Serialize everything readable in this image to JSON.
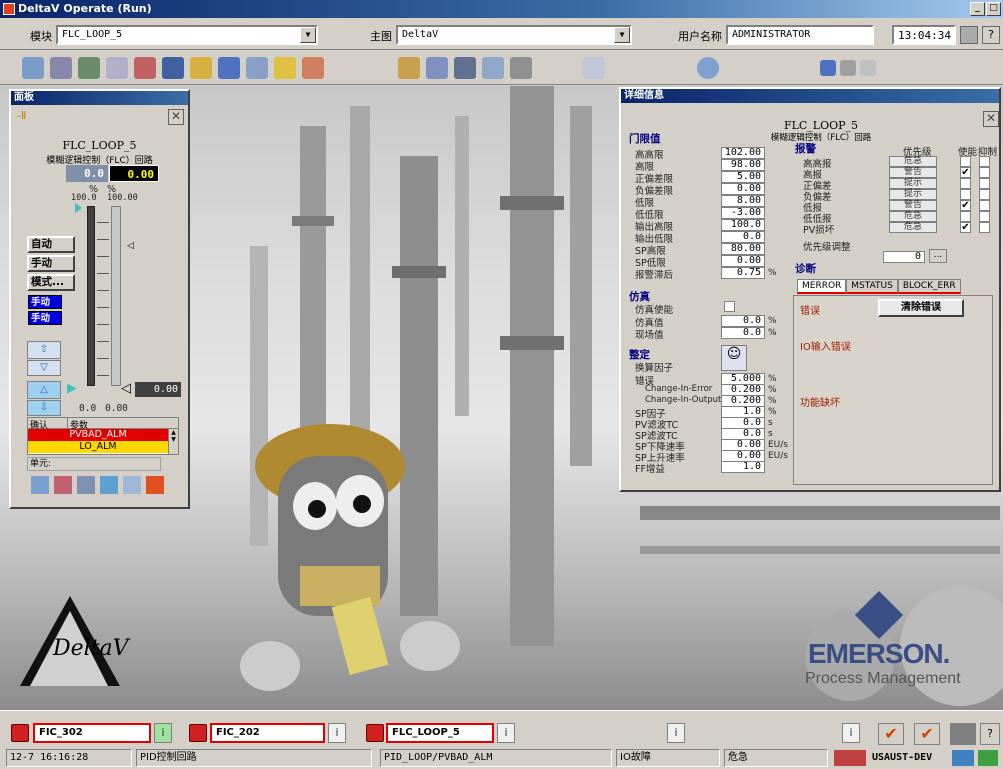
{
  "title_bar": {
    "title": "DeltaV Operate (Run)",
    "buttons": [
      "_",
      "□"
    ]
  },
  "infobar": {
    "module_label": "模块",
    "module_value": "FLC_LOOP_5",
    "main_label": "主图",
    "main_value": "DeltaV",
    "user_label": "用户名称",
    "user_value": "ADMINISTRATOR",
    "time": "13:04:34",
    "help": "?"
  },
  "faceplate": {
    "title": "面板",
    "tag": "FLC_LOOP_5",
    "desc": "模糊逻辑控制（FLC）回路",
    "pv": "0.0",
    "sp": "0.00",
    "unit1": "%",
    "unit2": "%",
    "scale_lo": "100.0",
    "scale_hi": "100.00",
    "auto_btn": "自动",
    "manual_btn": "手动",
    "mode_btn": "模式...",
    "mode_actual": "手动",
    "mode_target": "手动",
    "out_value": "0.00",
    "bottom_left": "0.0",
    "bottom_right": "0.00",
    "alarm_header": [
      "确认",
      "参数"
    ],
    "alarms": [
      "PVBAD_ALM",
      "LO_ALM"
    ],
    "unit_label": "单元:"
  },
  "detail": {
    "title": "详细信息",
    "tag": "FLC_LOOP_5",
    "desc": "模糊逻辑控制（FLC）回路",
    "limits_title": "门限值",
    "limits": [
      {
        "label": "高高限",
        "value": "102.00"
      },
      {
        "label": "高限",
        "value": "98.00"
      },
      {
        "label": "正偏差限",
        "value": "5.00"
      },
      {
        "label": "负偏差限",
        "value": "0.00"
      },
      {
        "label": "低限",
        "value": "8.00"
      },
      {
        "label": "低低限",
        "value": "-3.00"
      },
      {
        "label": "输出高限",
        "value": "100.0"
      },
      {
        "label": "输出低限",
        "value": "0.0"
      },
      {
        "label": "SP高限",
        "value": "80.00"
      },
      {
        "label": "SP低限",
        "value": "0.00"
      },
      {
        "label": "报警滞后",
        "value": "0.75",
        "unit": "%"
      }
    ],
    "sim_title": "仿真",
    "sim_enable": "仿真使能",
    "sim_value_label": "仿真值",
    "sim_value": "0.0",
    "field_value_label": "现场值",
    "field_value": "0.0",
    "pct": "%",
    "tune_title": "整定",
    "tune_factor": "换算因子",
    "tune": [
      {
        "label": "错误",
        "value": "5.000",
        "unit": "%"
      },
      {
        "label": "Change-In-Error",
        "value": "0.200",
        "unit": "%"
      },
      {
        "label": "Change-In-Output",
        "value": "0.200",
        "unit": "%"
      },
      {
        "label": "SP因子",
        "value": "1.0",
        "unit": "%"
      },
      {
        "label": "PV滤波TC",
        "value": "0.0",
        "unit": "s"
      },
      {
        "label": "SP滤波TC",
        "value": "0.0",
        "unit": "s"
      },
      {
        "label": "SP下降速率",
        "value": "0.00",
        "unit": "EU/s"
      },
      {
        "label": "SP上升速率",
        "value": "0.00",
        "unit": "EU/s"
      },
      {
        "label": "FF增益",
        "value": "1.0",
        "unit": ""
      }
    ],
    "alarm_title": "报警",
    "prio_header": "优先级",
    "enable_header": "使能",
    "suppress_header": "抑制",
    "alarms": [
      {
        "label": "高高报",
        "prio": "危急",
        "en": false
      },
      {
        "label": "高报",
        "prio": "警告",
        "en": true
      },
      {
        "label": "正偏差",
        "prio": "提示",
        "en": false
      },
      {
        "label": "负偏差",
        "prio": "提示",
        "en": false
      },
      {
        "label": "低报",
        "prio": "警告",
        "en": true
      },
      {
        "label": "低低报",
        "prio": "危急",
        "en": false
      },
      {
        "label": "PV损坏",
        "prio": "危急",
        "en": true
      }
    ],
    "prio_adjust": "优先级调整",
    "prio_adjust_val": "0",
    "ellipsis": "...",
    "diag_title": "诊断",
    "tabs": [
      "MERROR",
      "MSTATUS",
      "BLOCK_ERR"
    ],
    "err_label": "错误",
    "clear_btn": "清除错误",
    "io_err": "IO输入错误",
    "func_err": "功能缺坏"
  },
  "branding": {
    "deltav": "DeltaV",
    "emerson": "EMERSON.",
    "emerson_sub": "Process Management"
  },
  "alarm_banner": [
    {
      "tag": "FIC_302"
    },
    {
      "tag": "FIC_202"
    },
    {
      "tag": "FLC_LOOP_5"
    }
  ],
  "info_btn": "i",
  "status": {
    "time": "12-7 16:16:28",
    "desc": "PID控制回路",
    "path": "PID_LOOP/PVBAD_ALM",
    "type": "IO故障",
    "prio": "危急",
    "node": "USAUST-DEV",
    "help": "?"
  }
}
